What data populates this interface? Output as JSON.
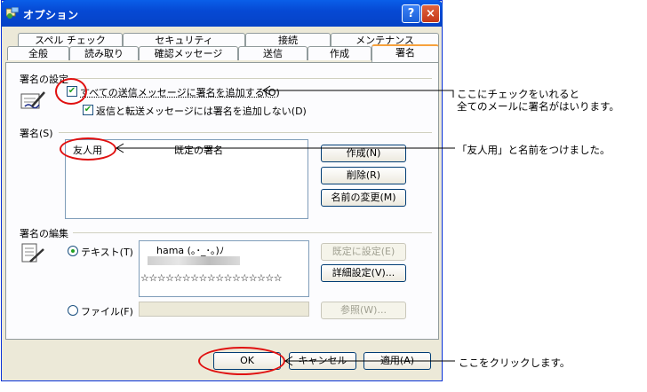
{
  "window": {
    "title": "オプション",
    "help_glyph": "?",
    "close_glyph": "×"
  },
  "tabs_back": [
    "スペル チェック",
    "セキュリティ",
    "接続",
    "メンテナンス"
  ],
  "tabs_front": [
    "全般",
    "読み取り",
    "確認メッセージ",
    "送信",
    "作成",
    "署名"
  ],
  "active_tab": "署名",
  "signature_settings": {
    "group_label": "署名の設定",
    "add_all_label": "すべての送信メッセージに署名を追加する(O)",
    "add_all_checked": true,
    "no_reply_label": "返信と転送メッセージには署名を追加しない(D)",
    "no_reply_checked": true
  },
  "signatures": {
    "group_label": "署名(S)",
    "list_name": "友人用",
    "list_default": "既定の署名",
    "create_button": "作成(N)",
    "delete_button": "削除(R)",
    "rename_button": "名前の変更(M)"
  },
  "edit": {
    "group_label": "署名の編集",
    "text_option": "テキスト(T)",
    "text_line1": "hama (｡･_･｡)ﾉ",
    "text_line3": "☆☆☆☆☆☆☆☆☆☆☆☆☆☆☆☆☆",
    "set_default_button": "既定に設定(E)",
    "advanced_button": "詳細設定(V)...",
    "file_option": "ファイル(F)",
    "browse_button": "参照(W)..."
  },
  "footer": {
    "ok_button": "OK",
    "cancel_button": "キャンセル",
    "apply_button": "適用(A)"
  },
  "annotations": {
    "note1_line1": "ここにチェックをいれると",
    "note1_line2": "全てのメールに署名がはいります。",
    "note2": "「友人用」と名前をつけました。",
    "note3": "ここをクリックします。"
  },
  "colors": {
    "titlebar": "#0a5fe9",
    "dialog_bg": "#ece9d8",
    "active_tab_accent": "#f7a13c",
    "annotation_red": "#e01010"
  }
}
